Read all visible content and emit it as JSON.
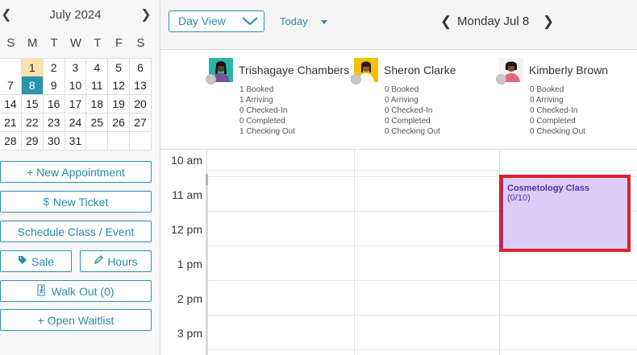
{
  "mini_calendar": {
    "month_label": "July 2024",
    "weekday_headers": [
      "S",
      "M",
      "T",
      "W",
      "T",
      "F",
      "S"
    ],
    "weeks": [
      [
        "",
        "1",
        "2",
        "3",
        "4",
        "5",
        "6"
      ],
      [
        "7",
        "8",
        "9",
        "10",
        "11",
        "12",
        "13"
      ],
      [
        "14",
        "15",
        "16",
        "17",
        "18",
        "19",
        "20"
      ],
      [
        "21",
        "22",
        "23",
        "24",
        "25",
        "26",
        "27"
      ],
      [
        "28",
        "29",
        "30",
        "31",
        "",
        "",
        ""
      ]
    ],
    "today": "1",
    "selected": "8"
  },
  "sidebar": {
    "new_appointment": "+ New Appointment",
    "new_ticket": "New Ticket",
    "new_ticket_icon": "$",
    "schedule_class": "Schedule Class / Event",
    "sale": "Sale",
    "sale_icon": "tag-icon",
    "hours": "Hours",
    "hours_icon": "pencil-icon",
    "walk_out": "Walk Out (0)",
    "walk_out_icon": "walk-out-icon",
    "open_waitlist": "+ Open Waitlist"
  },
  "toolbar": {
    "view_selected": "Day View",
    "today_label": "Today",
    "current_date": "Monday Jul 8"
  },
  "staff": [
    {
      "name": "Trishagaye Chambers",
      "stats": [
        "1 Booked",
        "1 Arriving",
        "0 Checked-In",
        "0 Completed",
        "1 Checking Out"
      ]
    },
    {
      "name": "Sheron Clarke",
      "stats": [
        "0 Booked",
        "0 Arriving",
        "0 Checked-In",
        "0 Completed",
        "0 Checking Out"
      ]
    },
    {
      "name": "Kimberly Brown",
      "stats": [
        "0 Booked",
        "0 Arriving",
        "0 Checked-In",
        "0 Completed",
        "0 Checking Out"
      ]
    }
  ],
  "time_labels": [
    "10 am",
    "11 am",
    "12 pm",
    "1 pm",
    "2 pm",
    "3 pm"
  ],
  "event": {
    "title": "Cosmetology Class",
    "subtitle": "(0/10)",
    "color": "#dccdf6",
    "accent": "#6b35c2"
  },
  "colors": {
    "accent": "#2a93b0",
    "today_bg": "#fbe3b0",
    "highlight": "#e0202a"
  }
}
